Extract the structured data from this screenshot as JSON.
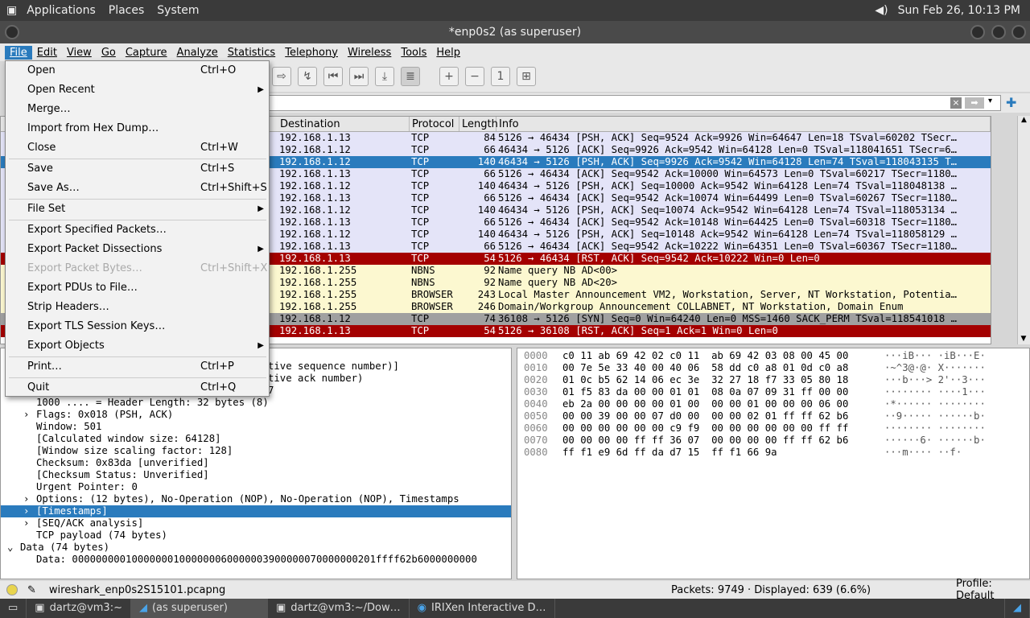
{
  "top_panel": {
    "menus": [
      "Applications",
      "Places",
      "System"
    ],
    "clock": "Sun Feb 26, 10:13 PM"
  },
  "window": {
    "title": "*enp0s2 (as superuser)"
  },
  "menubar": [
    "File",
    "Edit",
    "View",
    "Go",
    "Capture",
    "Analyze",
    "Statistics",
    "Telephony",
    "Wireless",
    "Tools",
    "Help"
  ],
  "packet_columns": [
    "Destination",
    "Protocol",
    "Length",
    "Info"
  ],
  "packets": [
    {
      "dst": "192.168.1.13",
      "proto": "TCP",
      "len": "84",
      "info": "5126 → 46434 [PSH, ACK] Seq=9524 Ack=9926 Win=64647 Len=18 TSval=60202 TSecr…",
      "style": "tcp"
    },
    {
      "dst": "192.168.1.12",
      "proto": "TCP",
      "len": "66",
      "info": "46434 → 5126 [ACK] Seq=9926 Ack=9542 Win=64128 Len=0 TSval=118041651 TSecr=6…",
      "style": "tcp"
    },
    {
      "dst": "192.168.1.12",
      "proto": "TCP",
      "len": "140",
      "info": "46434 → 5126 [PSH, ACK] Seq=9926 Ack=9542 Win=64128 Len=74 TSval=118043135 T…",
      "style": "sel"
    },
    {
      "dst": "192.168.1.13",
      "proto": "TCP",
      "len": "66",
      "info": "5126 → 46434 [ACK] Seq=9542 Ack=10000 Win=64573 Len=0 TSval=60217 TSecr=1180…",
      "style": "tcp"
    },
    {
      "dst": "192.168.1.12",
      "proto": "TCP",
      "len": "140",
      "info": "46434 → 5126 [PSH, ACK] Seq=10000 Ack=9542 Win=64128 Len=74 TSval=118048138 …",
      "style": "tcp"
    },
    {
      "dst": "192.168.1.13",
      "proto": "TCP",
      "len": "66",
      "info": "5126 → 46434 [ACK] Seq=9542 Ack=10074 Win=64499 Len=0 TSval=60267 TSecr=1180…",
      "style": "tcp"
    },
    {
      "dst": "192.168.1.12",
      "proto": "TCP",
      "len": "140",
      "info": "46434 → 5126 [PSH, ACK] Seq=10074 Ack=9542 Win=64128 Len=74 TSval=118053134 …",
      "style": "tcp"
    },
    {
      "dst": "192.168.1.13",
      "proto": "TCP",
      "len": "66",
      "info": "5126 → 46434 [ACK] Seq=9542 Ack=10148 Win=64425 Len=0 TSval=60318 TSecr=1180…",
      "style": "tcp"
    },
    {
      "dst": "192.168.1.12",
      "proto": "TCP",
      "len": "140",
      "info": "46434 → 5126 [PSH, ACK] Seq=10148 Ack=9542 Win=64128 Len=74 TSval=118058129 …",
      "style": "tcp"
    },
    {
      "dst": "192.168.1.13",
      "proto": "TCP",
      "len": "66",
      "info": "5126 → 46434 [ACK] Seq=9542 Ack=10222 Win=64351 Len=0 TSval=60367 TSecr=1180…",
      "style": "tcp"
    },
    {
      "dst": "192.168.1.13",
      "proto": "TCP",
      "len": "54",
      "info": "5126 → 46434 [RST, ACK] Seq=9542 Ack=10222 Win=0 Len=0",
      "style": "rst"
    },
    {
      "dst": "192.168.1.255",
      "proto": "NBNS",
      "len": "92",
      "info": "Name query NB AD<00>",
      "style": "udp"
    },
    {
      "dst": "192.168.1.255",
      "proto": "NBNS",
      "len": "92",
      "info": "Name query NB AD<20>",
      "style": "udp"
    },
    {
      "dst": "192.168.1.255",
      "proto": "BROWSER",
      "len": "243",
      "info": "Local Master Announcement VM2, Workstation, Server, NT Workstation, Potentia…",
      "style": "udp"
    },
    {
      "dst": "192.168.1.255",
      "proto": "BROWSER",
      "len": "246",
      "info": "Domain/Workgroup Announcement COLLABNET, NT Workstation, Domain Enum",
      "style": "udp"
    },
    {
      "dst": "192.168.1.12",
      "proto": "TCP",
      "len": "74",
      "info": "36108 → 5126 [SYN] Seq=0 Win=64240 Len=0 MSS=1460 SACK_PERM TSval=118541018 …",
      "style": "syn"
    },
    {
      "dst": "192.168.1.13",
      "proto": "TCP",
      "len": "54",
      "info": "5126 → 36108 [RST, ACK] Seq=1 Ack=1 Win=0 Len=0",
      "style": "rst"
    }
  ],
  "details": [
    {
      "t": "tive sequence number)]",
      "ind": 0,
      "exp": "",
      "x": "332"
    },
    {
      "t": "tive ack number)",
      "ind": 0,
      "exp": "",
      "x": "332"
    },
    {
      "t": "7",
      "ind": 0,
      "exp": "",
      "x": "332"
    },
    {
      "t": "1000 .... = Header Length: 32 bytes (8)",
      "ind": 1,
      "exp": ""
    },
    {
      "t": "Flags: 0x018 (PSH, ACK)",
      "ind": 1,
      "exp": "›"
    },
    {
      "t": "Window: 501",
      "ind": 1,
      "exp": ""
    },
    {
      "t": "[Calculated window size: 64128]",
      "ind": 1,
      "exp": ""
    },
    {
      "t": "[Window size scaling factor: 128]",
      "ind": 1,
      "exp": ""
    },
    {
      "t": "Checksum: 0x83da [unverified]",
      "ind": 1,
      "exp": ""
    },
    {
      "t": "[Checksum Status: Unverified]",
      "ind": 1,
      "exp": ""
    },
    {
      "t": "Urgent Pointer: 0",
      "ind": 1,
      "exp": ""
    },
    {
      "t": "Options: (12 bytes), No-Operation (NOP), No-Operation (NOP), Timestamps",
      "ind": 1,
      "exp": "›"
    },
    {
      "t": "[Timestamps]",
      "ind": 1,
      "exp": "›",
      "sel": true
    },
    {
      "t": "[SEQ/ACK analysis]",
      "ind": 1,
      "exp": "›"
    },
    {
      "t": "TCP payload (74 bytes)",
      "ind": 1,
      "exp": ""
    },
    {
      "t": "Data (74 bytes)",
      "ind": 0,
      "exp": "⌄"
    },
    {
      "t": "Data: 000000000100000001000000060000003900000070000000201ffff62b6000000000",
      "ind": 1,
      "exp": ""
    }
  ],
  "bytes": [
    {
      "off": "0000",
      "hex": "c0 11 ab 69 42 02 c0 11  ab 69 42 03 08 00 45 00",
      "asc": "···iB··· ·iB···E·"
    },
    {
      "off": "0010",
      "hex": "00 7e 5e 33 40 00 40 06  58 dd c0 a8 01 0d c0 a8",
      "asc": "·~^3@·@· X·······"
    },
    {
      "off": "0020",
      "hex": "01 0c b5 62 14 06 ec 3e  32 27 18 f7 33 05 80 18",
      "asc": "···b···> 2'··3···"
    },
    {
      "off": "0030",
      "hex": "01 f5 83 da 00 00 01 01  08 0a 07 09 31 ff 00 00",
      "asc": "········ ····1···"
    },
    {
      "off": "0040",
      "hex": "eb 2a 00 00 00 00 01 00  00 00 01 00 00 00 06 00",
      "asc": "·*······ ········"
    },
    {
      "off": "0050",
      "hex": "00 00 39 00 00 07 d0 00  00 00 02 01 ff ff 62 b6",
      "asc": "··9····· ······b·"
    },
    {
      "off": "0060",
      "hex": "00 00 00 00 00 00 c9 f9  00 00 00 00 00 00 ff ff",
      "asc": "········ ········"
    },
    {
      "off": "0070",
      "hex": "00 00 00 00 ff ff 36 07  00 00 00 00 ff ff 62 b6",
      "asc": "······6· ······b·"
    },
    {
      "off": "0080",
      "hex": "ff f1 e9 6d ff da d7 15  ff f1 66 9a",
      "asc": "···m···· ··f·"
    }
  ],
  "status": {
    "file": "wireshark_enp0s2S15101.pcapng",
    "packets": "Packets: 9749 · Displayed: 639 (6.6%)",
    "profile": "Profile: Default"
  },
  "taskbar": [
    "dartz@vm3:~",
    "(as superuser)",
    "dartz@vm3:~/Dow…",
    "IRIXen Interactive D…"
  ],
  "file_menu": [
    {
      "label": "Open",
      "sc": "Ctrl+O"
    },
    {
      "label": "Open Recent",
      "sc": "",
      "sub": true
    },
    {
      "label": "Merge…",
      "sc": ""
    },
    {
      "label": "Import from Hex Dump…",
      "sc": ""
    },
    {
      "label": "Close",
      "sc": "Ctrl+W"
    },
    {
      "sep": true
    },
    {
      "label": "Save",
      "sc": "Ctrl+S"
    },
    {
      "label": "Save As…",
      "sc": "Ctrl+Shift+S"
    },
    {
      "sep": true
    },
    {
      "label": "File Set",
      "sc": "",
      "sub": true
    },
    {
      "sep": true
    },
    {
      "label": "Export Specified Packets…",
      "sc": ""
    },
    {
      "label": "Export Packet Dissections",
      "sc": "",
      "sub": true
    },
    {
      "label": "Export Packet Bytes…",
      "sc": "Ctrl+Shift+X",
      "dis": true
    },
    {
      "label": "Export PDUs to File…",
      "sc": ""
    },
    {
      "label": "Strip Headers…",
      "sc": ""
    },
    {
      "label": "Export TLS Session Keys…",
      "sc": ""
    },
    {
      "label": "Export Objects",
      "sc": "",
      "sub": true
    },
    {
      "sep": true
    },
    {
      "label": "Print…",
      "sc": "Ctrl+P"
    },
    {
      "sep": true
    },
    {
      "label": "Quit",
      "sc": "Ctrl+Q"
    }
  ],
  "colors": {
    "tcp": "#e4e4f8",
    "sel": "#2a7bbd",
    "rst": "#a40000",
    "udp": "#fcf8d0",
    "syn": "#a0a0a0"
  }
}
